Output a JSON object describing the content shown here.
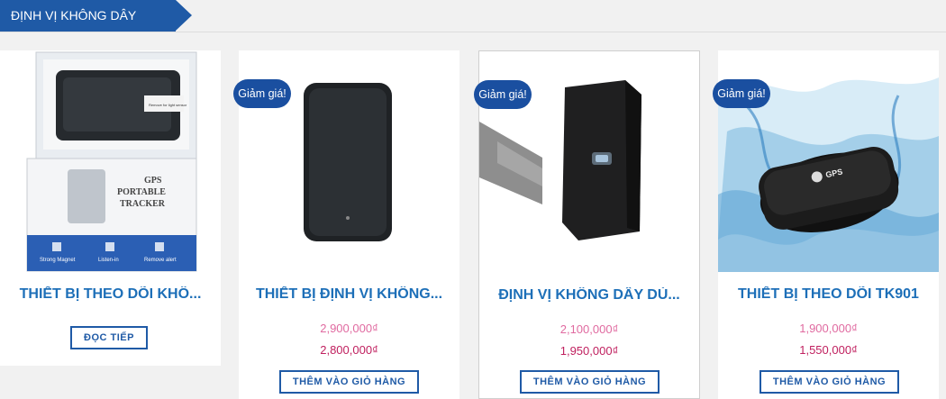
{
  "section": {
    "title": "ĐỊNH VỊ KHÔNG DÂY"
  },
  "products": [
    {
      "title": "THIẾT BỊ THEO DÕI KHÔ...",
      "button": "ĐỌC TIẾP",
      "box_text": [
        "GPS",
        "PORTABLE",
        "TRACKER"
      ],
      "box_icons": [
        "Strong Magnet",
        "Listen-in",
        "Remove alert"
      ],
      "device_label": "Remove for light sensor"
    },
    {
      "badge": "Giảm giá!",
      "title": "THIẾT BỊ ĐỊNH VỊ KHÔNG...",
      "price_old": "2,900,000₫",
      "price_new": "2,800,000₫",
      "button": "THÊM VÀO GIỎ HÀNG"
    },
    {
      "badge": "Giảm giá!",
      "title": "ĐỊNH VỊ KHÔNG DÂY DÙ...",
      "price_old": "2,100,000₫",
      "price_new": "1,950,000₫",
      "button": "THÊM VÀO GIỎ HÀNG"
    },
    {
      "badge": "Giảm giá!",
      "title": "THIẾT BỊ THEO DÕI TK901",
      "price_old": "1,900,000₫",
      "price_new": "1,550,000₫",
      "button": "THÊM VÀO GIỎ HÀNG",
      "device_label": "GPS"
    }
  ]
}
